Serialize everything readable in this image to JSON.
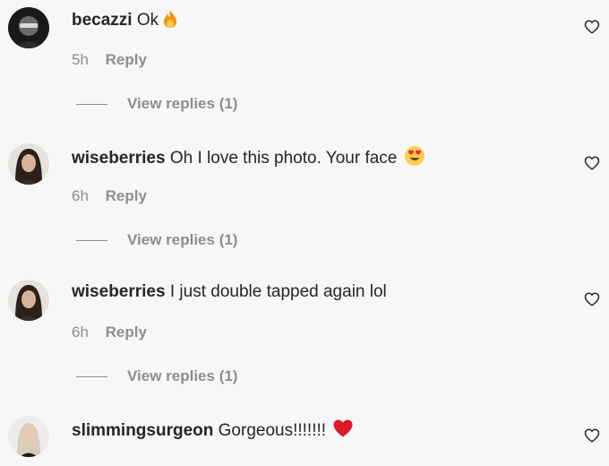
{
  "comments": [
    {
      "username": "becazzi",
      "text": "Ok",
      "emoji": "fire",
      "time": "5h",
      "reply_label": "Reply",
      "view_replies_label": "View replies (1)"
    },
    {
      "username": "wiseberries",
      "text": "Oh I love this photo. Your face",
      "emoji": "heart-eyes",
      "time": "6h",
      "reply_label": "Reply",
      "view_replies_label": "View replies (1)"
    },
    {
      "username": "wiseberries",
      "text": "I just double tapped again lol",
      "emoji": "",
      "time": "6h",
      "reply_label": "Reply",
      "view_replies_label": "View replies (1)"
    },
    {
      "username": "slimmingsurgeon",
      "text": "Gorgeous!!!!!!!",
      "emoji": "red-heart"
    }
  ],
  "colors": {
    "background": "#f7f7f7",
    "text": "#262626",
    "muted": "#8e8e8e",
    "emoji_heart": "#e0162b"
  }
}
